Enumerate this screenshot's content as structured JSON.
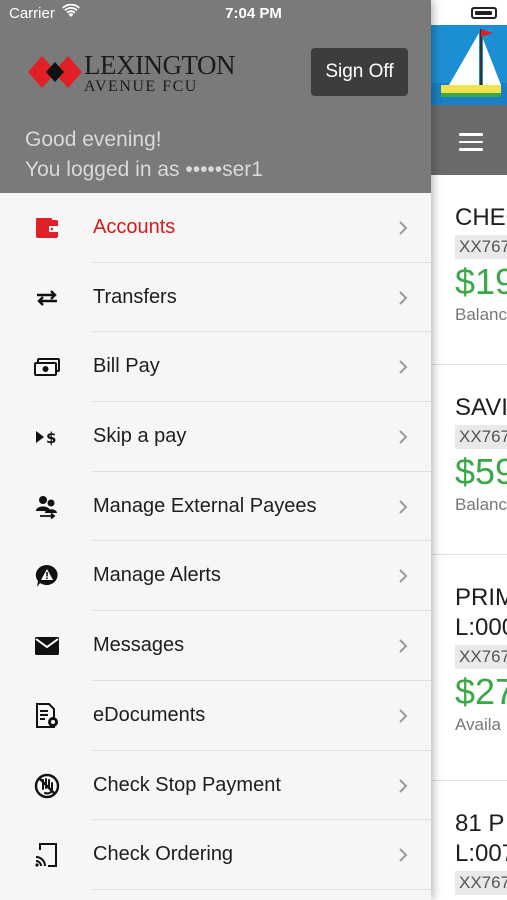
{
  "status_bar": {
    "carrier": "Carrier",
    "time": "7:04 PM"
  },
  "brand": {
    "name_line1": "LEXINGTON",
    "name_line2": "AVENUE FCU",
    "logo_color": "#e01f26"
  },
  "header": {
    "sign_off_label": "Sign Off",
    "greeting": "Good evening!",
    "logged_in_as": "You logged in as •••••ser1"
  },
  "menu": {
    "items": [
      {
        "label": "Accounts",
        "icon": "wallet-icon",
        "active": true
      },
      {
        "label": "Transfers",
        "icon": "transfer-arrows-icon"
      },
      {
        "label": "Bill Pay",
        "icon": "cash-icon"
      },
      {
        "label": "Skip a pay",
        "icon": "skip-pay-icon"
      },
      {
        "label": "Manage External Payees",
        "icon": "payees-icon"
      },
      {
        "label": "Manage Alerts",
        "icon": "alert-icon"
      },
      {
        "label": "Messages",
        "icon": "envelope-icon"
      },
      {
        "label": "eDocuments",
        "icon": "document-icon"
      },
      {
        "label": "Check Stop Payment",
        "icon": "stop-payment-icon"
      },
      {
        "label": "Check Ordering",
        "icon": "check-ordering-icon"
      }
    ]
  },
  "accounts_preview": {
    "cards": [
      {
        "name": "CHEC",
        "acct": "XX767",
        "amount": "$19",
        "label": "Balanc"
      },
      {
        "name": "SAVI",
        "acct": "XX767",
        "amount": "$59",
        "label": "Balanc"
      },
      {
        "name": "PRIM",
        "name2": "L:000",
        "acct": "XX767",
        "amount": "$27",
        "label": "Availa"
      },
      {
        "name": "81 P",
        "name2": "L:007",
        "acct": "XX767"
      }
    ]
  },
  "colors": {
    "header_bg": "#7a7a7a",
    "active_text": "#d71a1a",
    "amount_green": "#3aa849",
    "sign_off_bg": "#3d3d3d"
  }
}
